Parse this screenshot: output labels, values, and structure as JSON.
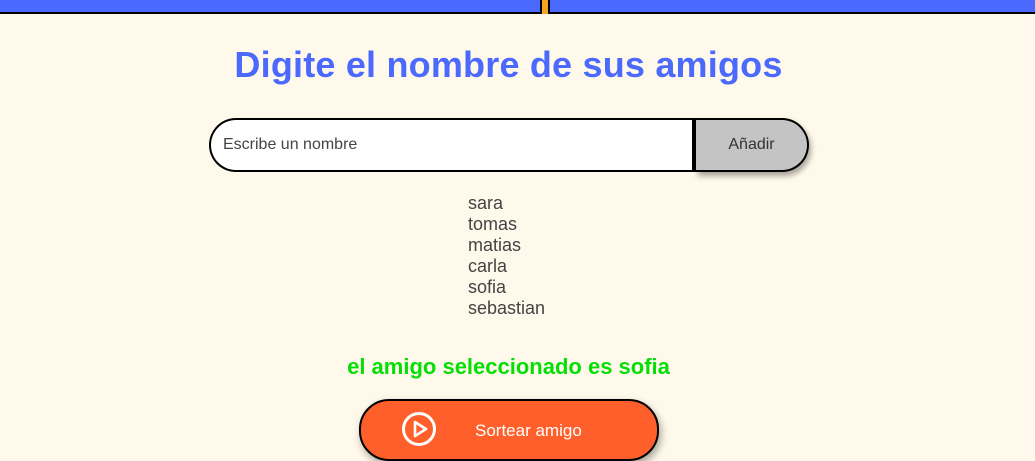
{
  "header": {
    "title": "Digite el nombre de sus amigos"
  },
  "form": {
    "input_value": "",
    "input_placeholder": "Escribe un nombre",
    "add_label": "Añadir"
  },
  "friends": [
    "sara",
    "tomas",
    "matias",
    "carla",
    "sofia",
    "sebastian"
  ],
  "result_text": "el amigo seleccionado es sofia",
  "draw_button": {
    "label": "Sortear amigo",
    "icon": "play-circle-icon"
  },
  "colors": {
    "background": "#FFF9EB",
    "accent_blue": "#4B69FD",
    "result_green": "#05DF05",
    "button_orange": "#FF5F2A",
    "add_button_gray": "#C4C4C4"
  }
}
